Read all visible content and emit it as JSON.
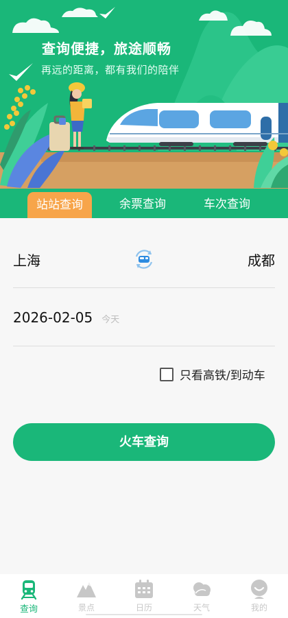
{
  "banner": {
    "title": "查询便捷，旅途顺畅",
    "subtitle": "再远的距离，都有我们的陪伴"
  },
  "tabs": [
    {
      "label": "站站查询",
      "active": true
    },
    {
      "label": "余票查询",
      "active": false
    },
    {
      "label": "车次查询",
      "active": false
    }
  ],
  "form": {
    "from_station": "上海",
    "to_station": "成都",
    "date": "2026-02-05",
    "date_hint": "今天",
    "gaotie_label": "只看高铁/到动车",
    "gaotie_checked": false,
    "search_label": "火车查询"
  },
  "nav": [
    {
      "label": "查询",
      "icon": "train-icon",
      "active": true
    },
    {
      "label": "景点",
      "icon": "mountain-icon",
      "active": false
    },
    {
      "label": "日历",
      "icon": "calendar-icon",
      "active": false
    },
    {
      "label": "天气",
      "icon": "cloud-icon",
      "active": false
    },
    {
      "label": "我的",
      "icon": "profile-icon",
      "active": false
    }
  ],
  "colors": {
    "primary": "#1ab779",
    "accent": "#f7a54a"
  }
}
